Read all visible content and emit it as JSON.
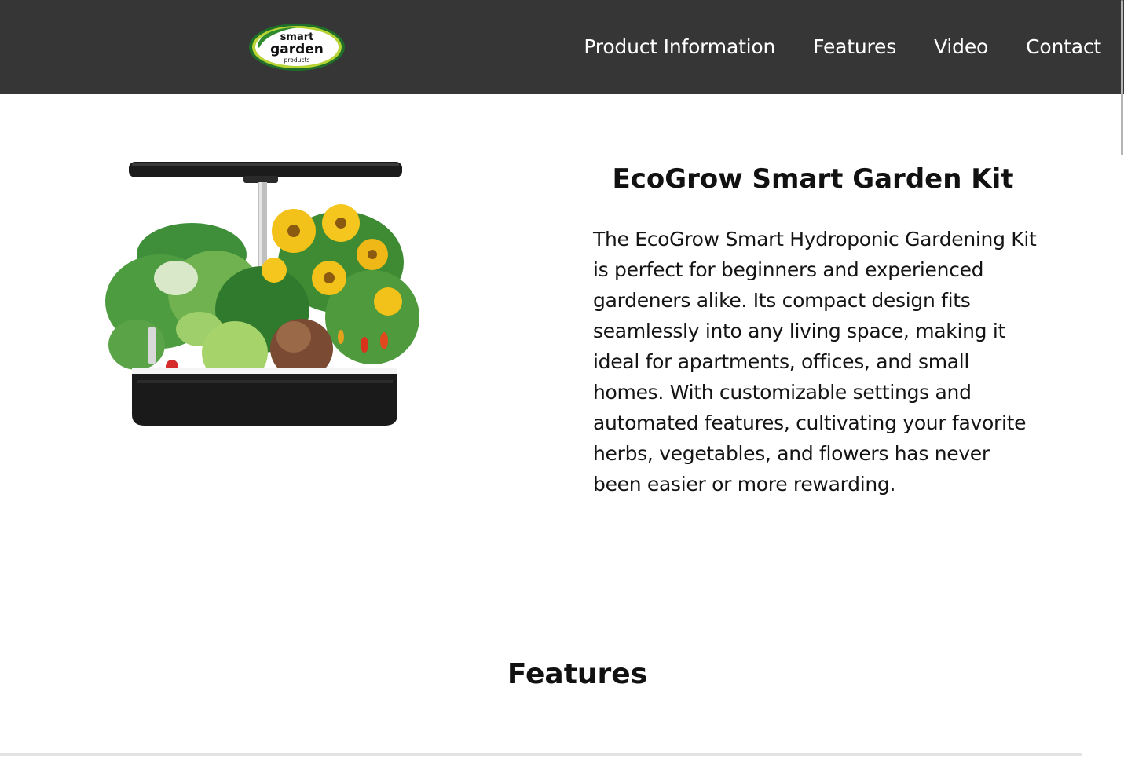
{
  "header": {
    "logo": {
      "line1": "smart",
      "line2": "garden",
      "line3": "products"
    },
    "nav": [
      {
        "label": "Product Information"
      },
      {
        "label": "Features"
      },
      {
        "label": "Video"
      },
      {
        "label": "Contact"
      }
    ]
  },
  "product": {
    "title": "EcoGrow Smart Garden Kit",
    "description": "The EcoGrow Smart Hydroponic Gardening Kit is perfect for beginners and experienced gardeners alike. Its compact design fits seamlessly into any living space, making it ideal for apartments, offices, and small homes. With customizable settings and automated features, cultivating your favorite herbs, vegetables, and flowers has never been easier or more rewarding."
  },
  "features": {
    "heading": "Features"
  },
  "colors": {
    "header_bg": "#363636",
    "nav_text": "#ffffff",
    "logo_green": "#2e8b2e",
    "logo_lime": "#b7d334"
  }
}
